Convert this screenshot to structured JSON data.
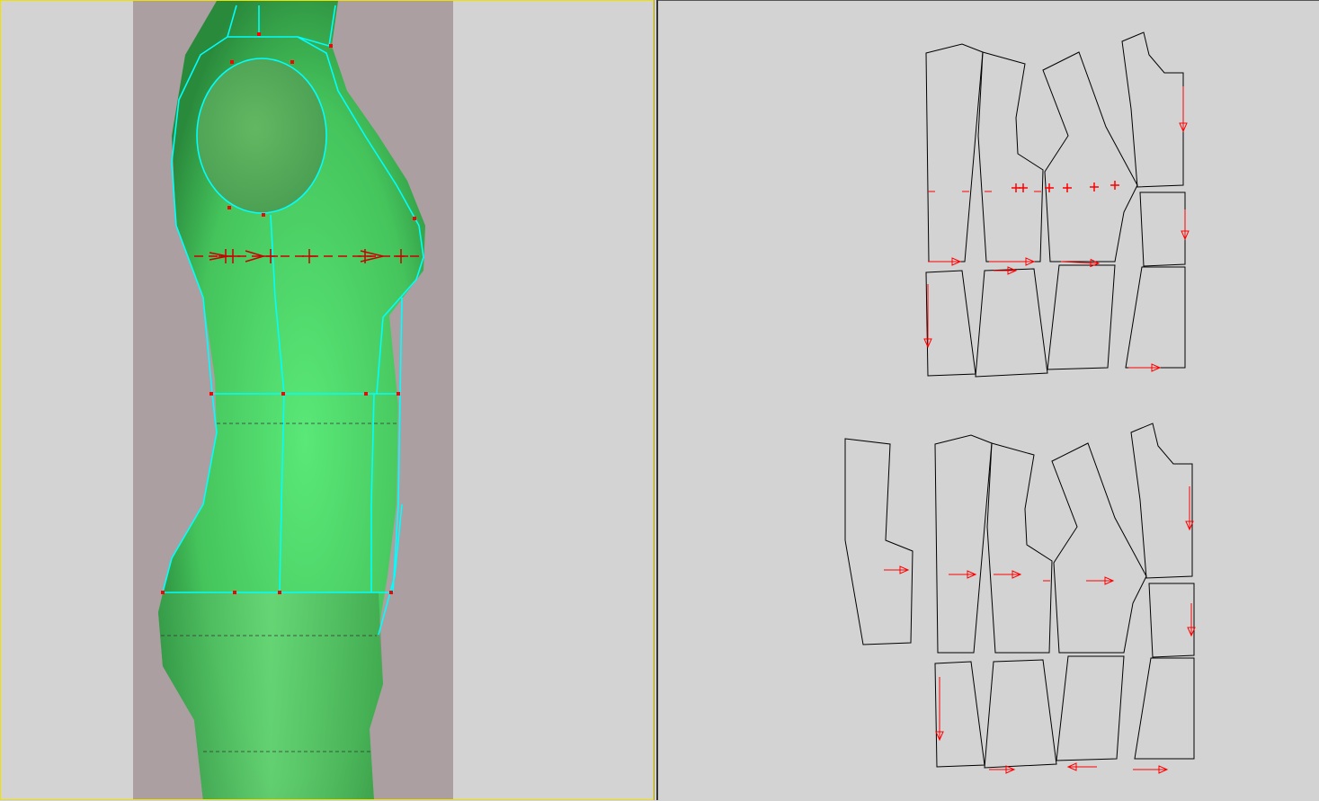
{
  "app": {
    "views": [
      {
        "id": "3d-view",
        "active": true
      },
      {
        "id": "pattern-2d-view",
        "active": false
      }
    ]
  },
  "colors": {
    "active_border": "#f0e000",
    "backdrop": "#ab9fa2",
    "mannequin": "#4fd46a",
    "seam_line": "#00ffff",
    "marker": "#ff0000",
    "pattern_outline": "#000000",
    "background": "#d3d3d3"
  }
}
